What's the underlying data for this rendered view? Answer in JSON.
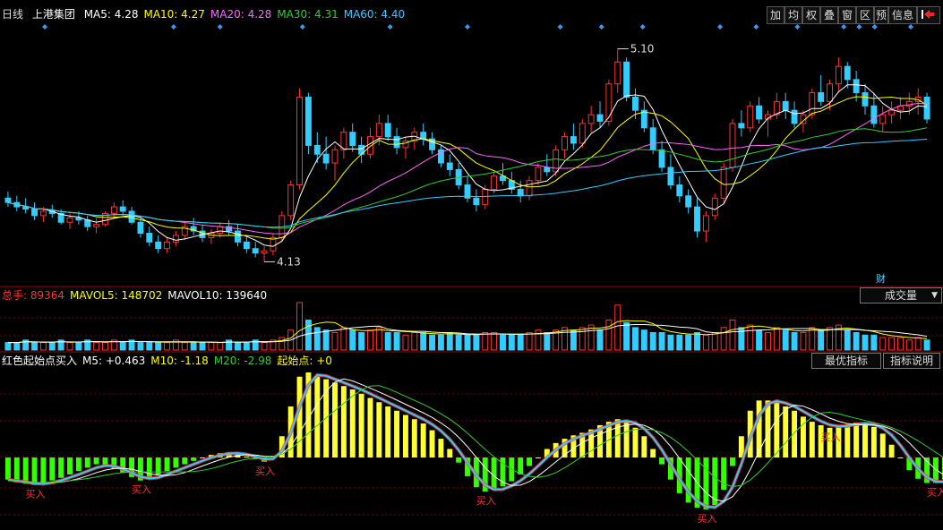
{
  "price_panel": {
    "period": "日线",
    "stock": "上港集团",
    "ma": [
      {
        "label": "MA5: 4.28",
        "color": "#ffffff"
      },
      {
        "label": "MA10: 4.27",
        "color": "#ffff00"
      },
      {
        "label": "MA20: 4.28",
        "color": "#ff66ff"
      },
      {
        "label": "MA30: 4.31",
        "color": "#33cc33"
      },
      {
        "label": "MA60: 4.40",
        "color": "#33ccff"
      }
    ],
    "high_label": "5.10",
    "low_label": "4.13",
    "cai_label": "财"
  },
  "toolbar": {
    "buttons": [
      "加",
      "均",
      "权",
      "叠",
      "窗",
      "区",
      "预",
      "信息"
    ],
    "exit_icon": "exit-icon"
  },
  "volume_panel": {
    "items": [
      {
        "label": "总手: 89364",
        "color": "#ff3333"
      },
      {
        "label": "MAVOL5: 148702",
        "color": "#ffff00"
      },
      {
        "label": "MAVOL10: 139640",
        "color": "#ffffff"
      }
    ],
    "selector": "成交量"
  },
  "indicator_panel": {
    "items": [
      {
        "label": "红色起始点买入",
        "color": "#ffffff"
      },
      {
        "label": "M5: +0.463",
        "color": "#ffffff"
      },
      {
        "label": "M10: -1.18",
        "color": "#ffff00"
      },
      {
        "label": "M20: -2.98",
        "color": "#33cc33"
      },
      {
        "label": "起始点: +0",
        "color": "#ffff00"
      }
    ],
    "btn_best": "最优指标",
    "btn_desc": "指标说明",
    "buy_label": "买入"
  },
  "colors": {
    "up": "#ff3333",
    "down": "#33ccff",
    "grid": "#800000",
    "green_bar": "#33ff00",
    "yellow_bar": "#ffff33"
  },
  "chart_data": {
    "type": "candlestick",
    "ylim": [
      4.05,
      5.2
    ],
    "candles": [
      [
        4.42,
        4.45,
        4.38,
        4.4
      ],
      [
        4.4,
        4.43,
        4.36,
        4.38
      ],
      [
        4.38,
        4.42,
        4.35,
        4.37
      ],
      [
        4.37,
        4.4,
        4.32,
        4.34
      ],
      [
        4.34,
        4.38,
        4.31,
        4.36
      ],
      [
        4.36,
        4.39,
        4.33,
        4.35
      ],
      [
        4.35,
        4.37,
        4.3,
        4.31
      ],
      [
        4.31,
        4.35,
        4.28,
        4.33
      ],
      [
        4.33,
        4.36,
        4.3,
        4.32
      ],
      [
        4.32,
        4.34,
        4.27,
        4.29
      ],
      [
        4.29,
        4.33,
        4.26,
        4.3
      ],
      [
        4.3,
        4.36,
        4.29,
        4.35
      ],
      [
        4.35,
        4.4,
        4.33,
        4.38
      ],
      [
        4.38,
        4.41,
        4.34,
        4.36
      ],
      [
        4.36,
        4.38,
        4.3,
        4.31
      ],
      [
        4.31,
        4.33,
        4.24,
        4.26
      ],
      [
        4.26,
        4.29,
        4.2,
        4.22
      ],
      [
        4.22,
        4.25,
        4.17,
        4.19
      ],
      [
        4.19,
        4.24,
        4.17,
        4.22
      ],
      [
        4.22,
        4.27,
        4.2,
        4.25
      ],
      [
        4.25,
        4.31,
        4.23,
        4.29
      ],
      [
        4.29,
        4.33,
        4.25,
        4.27
      ],
      [
        4.27,
        4.3,
        4.22,
        4.24
      ],
      [
        4.24,
        4.28,
        4.21,
        4.26
      ],
      [
        4.26,
        4.31,
        4.24,
        4.29
      ],
      [
        4.29,
        4.32,
        4.25,
        4.27
      ],
      [
        4.27,
        4.3,
        4.2,
        4.22
      ],
      [
        4.22,
        4.25,
        4.17,
        4.19
      ],
      [
        4.19,
        4.22,
        4.15,
        4.17
      ],
      [
        4.17,
        4.2,
        4.13,
        4.18
      ],
      [
        4.18,
        4.26,
        4.16,
        4.24
      ],
      [
        4.24,
        4.36,
        4.22,
        4.34
      ],
      [
        4.34,
        4.5,
        4.32,
        4.48
      ],
      [
        4.48,
        4.92,
        4.46,
        4.88
      ],
      [
        4.88,
        4.9,
        4.62,
        4.66
      ],
      [
        4.66,
        4.72,
        4.58,
        4.62
      ],
      [
        4.62,
        4.7,
        4.55,
        4.58
      ],
      [
        4.58,
        4.66,
        4.5,
        4.64
      ],
      [
        4.64,
        4.74,
        4.6,
        4.72
      ],
      [
        4.72,
        4.76,
        4.63,
        4.66
      ],
      [
        4.66,
        4.7,
        4.58,
        4.62
      ],
      [
        4.62,
        4.74,
        4.6,
        4.7
      ],
      [
        4.7,
        4.8,
        4.66,
        4.76
      ],
      [
        4.76,
        4.8,
        4.68,
        4.7
      ],
      [
        4.7,
        4.74,
        4.62,
        4.65
      ],
      [
        4.65,
        4.7,
        4.6,
        4.68
      ],
      [
        4.68,
        4.74,
        4.64,
        4.72
      ],
      [
        4.72,
        4.76,
        4.66,
        4.69
      ],
      [
        4.69,
        4.72,
        4.62,
        4.64
      ],
      [
        4.64,
        4.66,
        4.56,
        4.58
      ],
      [
        4.58,
        4.62,
        4.52,
        4.55
      ],
      [
        4.55,
        4.58,
        4.46,
        4.48
      ],
      [
        4.48,
        4.52,
        4.4,
        4.42
      ],
      [
        4.42,
        4.46,
        4.36,
        4.39
      ],
      [
        4.39,
        4.48,
        4.37,
        4.46
      ],
      [
        4.46,
        4.54,
        4.44,
        4.52
      ],
      [
        4.52,
        4.58,
        4.48,
        4.5
      ],
      [
        4.5,
        4.54,
        4.44,
        4.46
      ],
      [
        4.46,
        4.5,
        4.4,
        4.43
      ],
      [
        4.43,
        4.52,
        4.41,
        4.5
      ],
      [
        4.5,
        4.58,
        4.48,
        4.56
      ],
      [
        4.56,
        4.62,
        4.52,
        4.54
      ],
      [
        4.54,
        4.66,
        4.52,
        4.64
      ],
      [
        4.64,
        4.72,
        4.6,
        4.7
      ],
      [
        4.7,
        4.76,
        4.64,
        4.67
      ],
      [
        4.67,
        4.78,
        4.65,
        4.76
      ],
      [
        4.76,
        4.84,
        4.72,
        4.8
      ],
      [
        4.8,
        4.86,
        4.74,
        4.77
      ],
      [
        4.77,
        4.96,
        4.75,
        4.94
      ],
      [
        4.94,
        5.1,
        4.9,
        5.04
      ],
      [
        5.04,
        5.06,
        4.86,
        4.88
      ],
      [
        4.88,
        4.92,
        4.78,
        4.82
      ],
      [
        4.82,
        4.86,
        4.72,
        4.74
      ],
      [
        4.74,
        4.78,
        4.62,
        4.64
      ],
      [
        4.64,
        4.68,
        4.54,
        4.56
      ],
      [
        4.56,
        4.62,
        4.46,
        4.48
      ],
      [
        4.48,
        4.52,
        4.4,
        4.43
      ],
      [
        4.43,
        4.46,
        4.35,
        4.38
      ],
      [
        4.38,
        4.42,
        4.24,
        4.27
      ],
      [
        4.27,
        4.36,
        4.22,
        4.34
      ],
      [
        4.34,
        4.44,
        4.32,
        4.42
      ],
      [
        4.42,
        4.58,
        4.4,
        4.56
      ],
      [
        4.56,
        4.78,
        4.54,
        4.76
      ],
      [
        4.76,
        4.82,
        4.7,
        4.74
      ],
      [
        4.74,
        4.86,
        4.72,
        4.84
      ],
      [
        4.84,
        4.88,
        4.76,
        4.78
      ],
      [
        4.78,
        4.82,
        4.7,
        4.8
      ],
      [
        4.8,
        4.9,
        4.78,
        4.86
      ],
      [
        4.86,
        4.9,
        4.78,
        4.82
      ],
      [
        4.82,
        4.86,
        4.74,
        4.76
      ],
      [
        4.76,
        4.82,
        4.72,
        4.8
      ],
      [
        4.8,
        4.92,
        4.78,
        4.9
      ],
      [
        4.9,
        4.98,
        4.84,
        4.86
      ],
      [
        4.86,
        4.96,
        4.82,
        4.94
      ],
      [
        4.94,
        5.06,
        4.9,
        5.02
      ],
      [
        5.02,
        5.04,
        4.92,
        4.96
      ],
      [
        4.96,
        5.0,
        4.86,
        4.9
      ],
      [
        4.9,
        4.94,
        4.8,
        4.84
      ],
      [
        4.84,
        4.9,
        4.74,
        4.76
      ],
      [
        4.76,
        4.84,
        4.72,
        4.8
      ],
      [
        4.8,
        4.86,
        4.76,
        4.82
      ],
      [
        4.82,
        4.88,
        4.78,
        4.84
      ],
      [
        4.84,
        4.9,
        4.8,
        4.86
      ],
      [
        4.86,
        4.92,
        4.8,
        4.88
      ],
      [
        4.88,
        4.9,
        4.76,
        4.78
      ]
    ],
    "volumes": [
      3,
      3,
      4,
      3,
      3,
      3,
      4,
      3,
      3,
      4,
      3,
      3,
      4,
      3,
      4,
      3,
      3,
      3,
      3,
      4,
      3,
      3,
      3,
      3,
      3,
      4,
      3,
      3,
      4,
      3,
      4,
      5,
      8,
      19,
      12,
      9,
      8,
      7,
      9,
      8,
      7,
      8,
      9,
      7,
      7,
      6,
      7,
      7,
      6,
      6,
      7,
      6,
      6,
      6,
      7,
      7,
      6,
      6,
      6,
      7,
      8,
      7,
      8,
      9,
      8,
      9,
      10,
      8,
      12,
      18,
      11,
      9,
      8,
      7,
      7,
      6,
      6,
      6,
      7,
      6,
      7,
      9,
      12,
      9,
      10,
      8,
      7,
      9,
      8,
      7,
      7,
      9,
      8,
      9,
      10,
      8,
      7,
      6,
      6,
      5,
      5,
      5,
      4,
      5,
      4
    ],
    "oscillator": [
      -2.6,
      -2.9,
      -3.1,
      -3.2,
      -3.0,
      -2.7,
      -2.4,
      -2.0,
      -1.6,
      -1.2,
      -0.8,
      -0.9,
      -1.3,
      -1.8,
      -2.3,
      -2.7,
      -2.4,
      -2.0,
      -1.6,
      -1.2,
      -0.8,
      -0.4,
      0.0,
      0.3,
      0.5,
      0.6,
      0.4,
      0.1,
      -0.2,
      -0.5,
      0.2,
      2.5,
      6.0,
      9.5,
      10.0,
      9.6,
      9.2,
      8.8,
      8.4,
      8.0,
      7.5,
      7.0,
      6.5,
      6.0,
      5.5,
      5.0,
      4.5,
      4.0,
      3.2,
      2.2,
      1.0,
      -0.6,
      -2.2,
      -3.5,
      -4.0,
      -3.8,
      -3.4,
      -2.8,
      -2.0,
      -1.0,
      0.0,
      1.0,
      1.7,
      2.2,
      2.6,
      2.9,
      3.3,
      3.8,
      4.2,
      4.5,
      4.2,
      3.5,
      2.5,
      1.0,
      -0.8,
      -2.6,
      -4.2,
      -5.3,
      -5.9,
      -6.1,
      -5.6,
      -3.8,
      -1.0,
      2.5,
      5.5,
      6.7,
      6.7,
      6.5,
      6.0,
      5.5,
      4.8,
      4.2,
      3.8,
      3.5,
      3.7,
      3.9,
      4.1,
      4.0,
      3.6,
      2.8,
      1.5,
      0.0,
      -1.5,
      -2.5,
      -3.0,
      -3.0,
      -2.6,
      -2.0
    ]
  }
}
